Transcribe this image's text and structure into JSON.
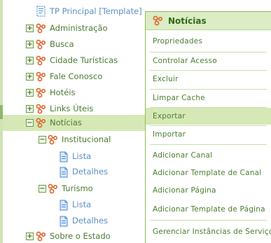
{
  "tree": {
    "nodes": [
      {
        "label": "TP Principal [Template]",
        "kind": "template"
      },
      {
        "label": "Administração",
        "kind": "channel"
      },
      {
        "label": "Busca",
        "kind": "channel"
      },
      {
        "label": "Cidade Turísticas",
        "kind": "channel"
      },
      {
        "label": "Fale Conosco",
        "kind": "channel"
      },
      {
        "label": "Hotéis",
        "kind": "channel"
      },
      {
        "label": "Links Úteis",
        "kind": "channel"
      },
      {
        "label": "Notícias",
        "kind": "channel",
        "selected": true
      },
      {
        "label": "Institucional",
        "kind": "channel"
      },
      {
        "label": "Lista",
        "kind": "page"
      },
      {
        "label": "Detalhes",
        "kind": "page"
      },
      {
        "label": "Turismo",
        "kind": "channel"
      },
      {
        "label": "Lista",
        "kind": "page"
      },
      {
        "label": "Detalhes",
        "kind": "page"
      },
      {
        "label": "Sobre o Estado",
        "kind": "channel"
      }
    ],
    "toggle_expand": "+",
    "toggle_collapse": "−"
  },
  "context_menu": {
    "title": "Notícias",
    "items": [
      "Propriedades",
      "Controlar Acesso",
      "Excluir",
      "Limpar Cache",
      "Exportar",
      "Importar",
      "Adicionar Canal",
      "Adicionar Template de Canal",
      "Adicionar Página",
      "Adicionar Template de Página",
      "Gerenciar Instâncias de Serviço"
    ],
    "hovered": "Exportar"
  },
  "colors": {
    "accent": "#8cbf5b",
    "selection": "#d6e8b6",
    "text": "#4b7a2f",
    "channel_icon": "#e0642a",
    "page_icon": "#4a88d6"
  }
}
